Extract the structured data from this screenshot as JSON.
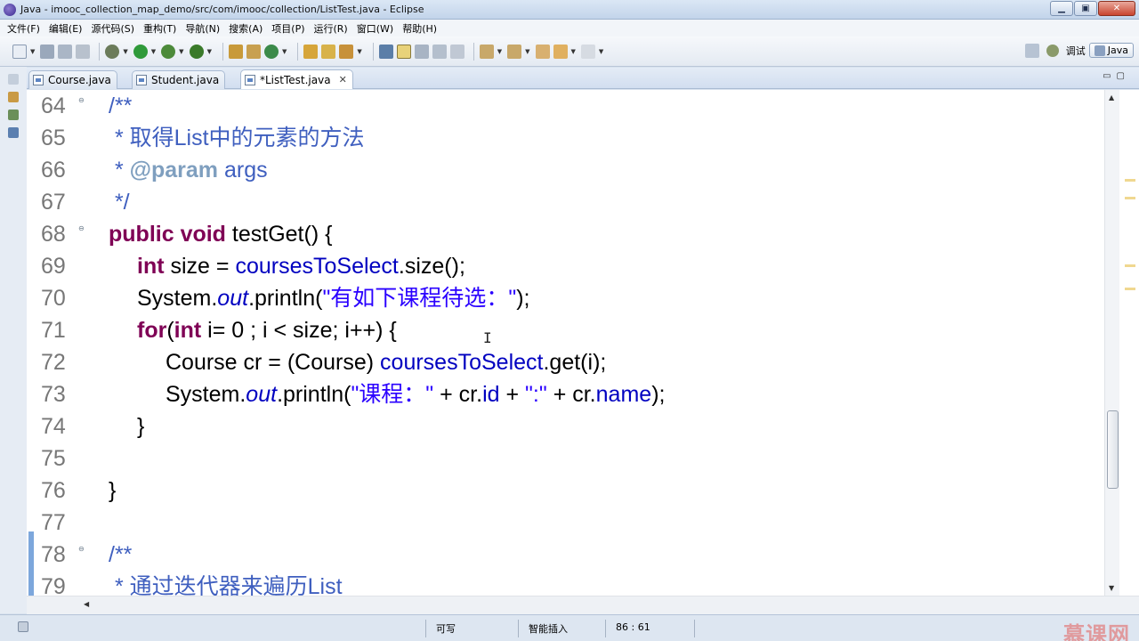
{
  "window": {
    "title": "Java - imooc_collection_map_demo/src/com/imooc/collection/ListTest.java - Eclipse",
    "min_label": "▁",
    "max_label": "▣",
    "close_label": "✕"
  },
  "menu": [
    "文件(F)",
    "编辑(E)",
    "源代码(S)",
    "重构(T)",
    "导航(N)",
    "搜索(A)",
    "项目(P)",
    "运行(R)",
    "窗口(W)",
    "帮助(H)"
  ],
  "perspectives": {
    "debug_label": "调试",
    "java_label": "Java"
  },
  "tabs": [
    {
      "label": "Course.java"
    },
    {
      "label": "Student.java"
    },
    {
      "label": "*ListTest.java",
      "close": "✕"
    }
  ],
  "view_buttons": "▭▢",
  "code_lines": [
    {
      "num": "64",
      "fold": "⊖"
    },
    {
      "num": "65"
    },
    {
      "num": "66"
    },
    {
      "num": "67"
    },
    {
      "num": "68",
      "fold": "⊖"
    },
    {
      "num": "69"
    },
    {
      "num": "70"
    },
    {
      "num": "71"
    },
    {
      "num": "72"
    },
    {
      "num": "73"
    },
    {
      "num": "74"
    },
    {
      "num": "75"
    },
    {
      "num": "76"
    },
    {
      "num": "77"
    },
    {
      "num": "78",
      "fold": "⊖"
    },
    {
      "num": "79"
    }
  ],
  "code": {
    "l64": "/**",
    "l65": " * 取得List中的元素的方法",
    "l66_star": " * ",
    "l66_tag": "@param",
    "l66_rest": " args",
    "l67": " */",
    "l68_kw1": "public",
    "l68_kw2": "void",
    "l68_rest": " testGet() {",
    "l69_kw": "int",
    "l69_a": " size = ",
    "l69_fld": "coursesToSelect",
    "l69_b": ".size();",
    "l70_a": "System.",
    "l70_out": "out",
    "l70_b": ".println(",
    "l70_str": "\"有如下课程待选：\"",
    "l70_c": ");",
    "l71_kw1": "for",
    "l71_a": "(",
    "l71_kw2": "int",
    "l71_b": " i= 0 ; i < size; i++) {",
    "l72_a": "Course cr = (Course) ",
    "l72_fld": "coursesToSelect",
    "l72_b": ".get(i);",
    "l73_a": "System.",
    "l73_out": "out",
    "l73_b": ".println(",
    "l73_str1": "\"课程：\"",
    "l73_c": " + cr.",
    "l73_id": "id",
    "l73_d": " + ",
    "l73_str2": "\":\"",
    "l73_e": " + cr.",
    "l73_name": "name",
    "l73_f": ");",
    "l74": "}",
    "l75": "",
    "l76": "}",
    "l77": "",
    "l78": "/**",
    "l79": " * 通过迭代器来遍历List"
  },
  "status": {
    "writable": "可写",
    "insert_mode": "智能插入",
    "position": "86 : 61",
    "watermark": "慕课网"
  },
  "colors": {
    "keyword": "#7f0055",
    "comment": "#3f5fbf",
    "string": "#2a00ff",
    "field": "#0000c0"
  }
}
